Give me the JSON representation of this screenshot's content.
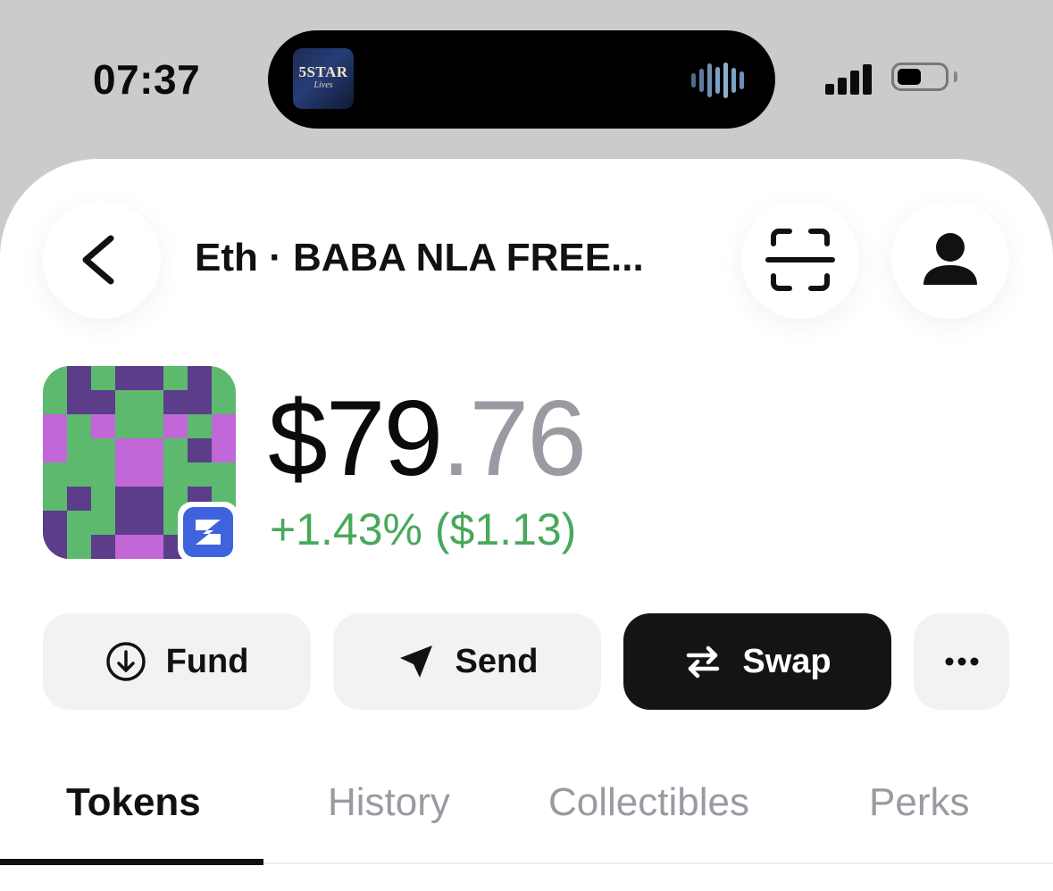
{
  "status_bar": {
    "time": "07:37",
    "now_playing_art": {
      "line1": "5STAR",
      "line2": "Lives"
    },
    "signal_icon": "cellular-signal-icon",
    "battery_icon": "battery-icon"
  },
  "header": {
    "back_icon": "chevron-left-icon",
    "title": "Eth · BABA NLA FREE...",
    "scan_icon": "scan-icon",
    "profile_icon": "person-icon"
  },
  "token": {
    "badge_icon": "zora-network-icon",
    "price_int": "$79",
    "price_dec": ".76",
    "change": "+1.43% ($1.13)",
    "colors": {
      "green": "#5cb96e",
      "purple": "#5b3d8a",
      "pink": "#c167d8"
    }
  },
  "actions": {
    "fund": "Fund",
    "send": "Send",
    "swap": "Swap",
    "more_icon": "more-horizontal-icon"
  },
  "tabs": [
    {
      "label": "Tokens",
      "active": true
    },
    {
      "label": "History",
      "active": false
    },
    {
      "label": "Collectibles",
      "active": false
    },
    {
      "label": "Perks",
      "active": false
    }
  ]
}
